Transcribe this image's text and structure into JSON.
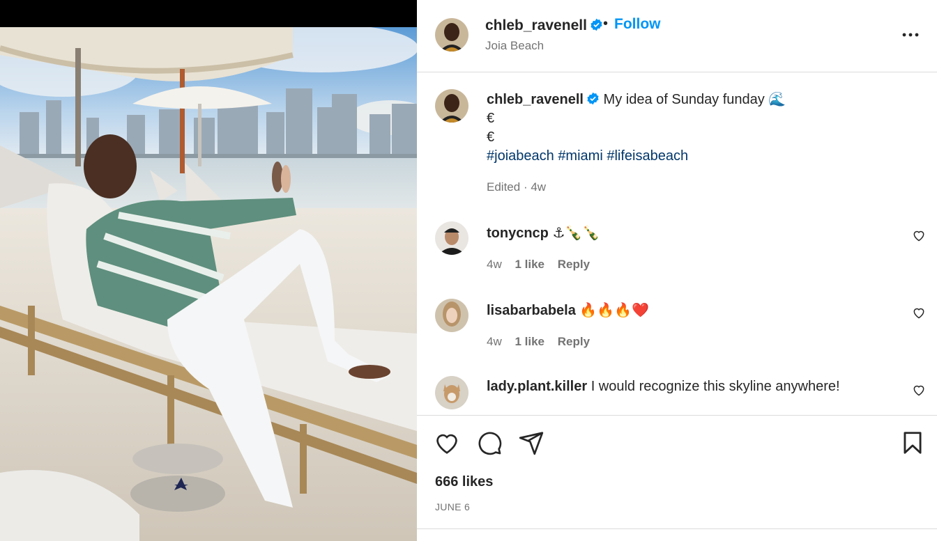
{
  "post": {
    "username": "chleb_ravenell",
    "follow_label": "Follow",
    "dot": "•",
    "location": "Joia Beach"
  },
  "caption": {
    "username": "chleb_ravenell",
    "text": "My idea of Sunday funday",
    "emoji": "🌊",
    "line2": "€",
    "line3": "€",
    "hashtags": [
      "#joiabeach",
      "#miami",
      "#lifeisabeach"
    ],
    "edited": "Edited",
    "sep": "·",
    "age": "4w"
  },
  "comments": [
    {
      "username": "tonycncp",
      "text": "⚓🍾🍾",
      "age": "4w",
      "likes": "1 like",
      "reply": "Reply"
    },
    {
      "username": "lisabarbabela",
      "text": "🔥🔥🔥❤️",
      "age": "4w",
      "likes": "1 like",
      "reply": "Reply"
    },
    {
      "username": "lady.plant.killer",
      "text": "I would recognize this skyline anywhere!"
    }
  ],
  "footer": {
    "likes": "666 likes",
    "date": "JUNE 6"
  },
  "colors": {
    "accent": "#0095f6",
    "hashtag": "#00376b",
    "muted": "#737373",
    "verified": "#0095f6",
    "divider": "#dbdbdb"
  },
  "icons": {
    "verified": "verified-badge-icon",
    "more": "more-options-icon",
    "heart": "heart-icon",
    "comment": "comment-icon",
    "share": "share-icon",
    "save": "bookmark-icon"
  }
}
